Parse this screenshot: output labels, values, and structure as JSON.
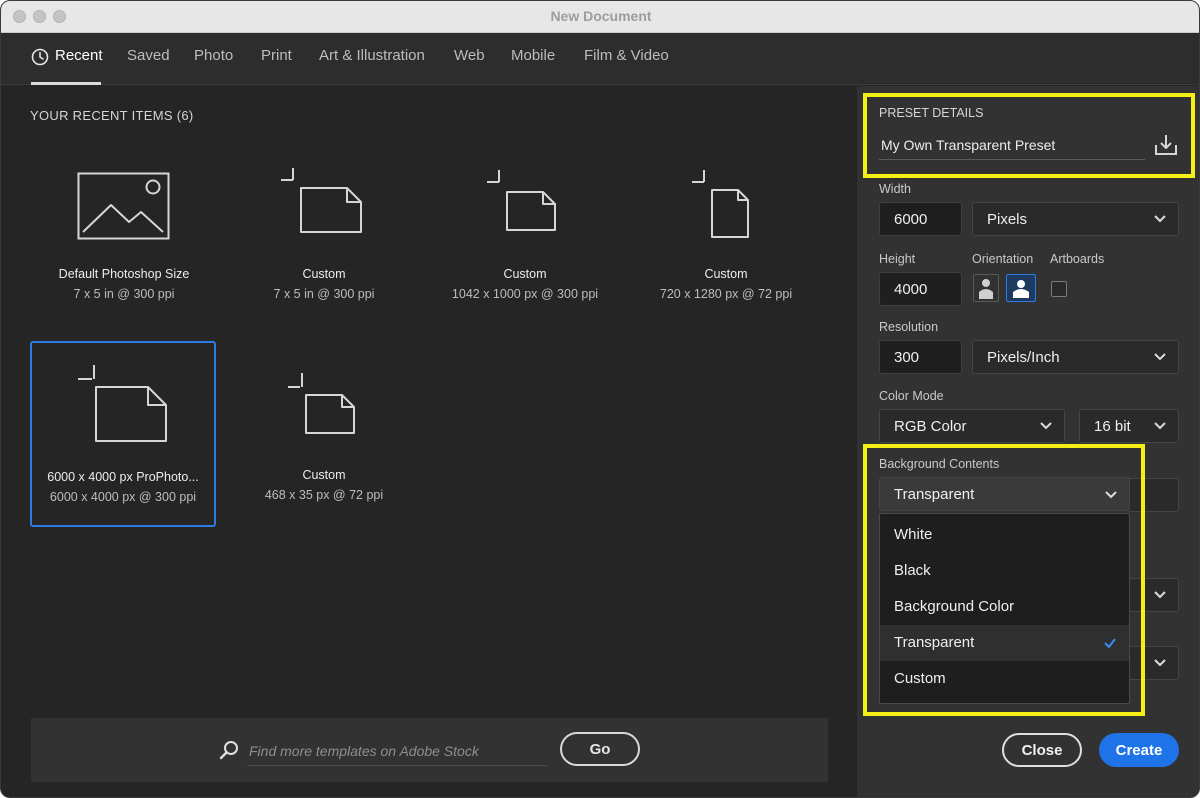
{
  "window": {
    "title": "New Document"
  },
  "tabs": [
    {
      "label": "Recent"
    },
    {
      "label": "Saved"
    },
    {
      "label": "Photo"
    },
    {
      "label": "Print"
    },
    {
      "label": "Art & Illustration"
    },
    {
      "label": "Web"
    },
    {
      "label": "Mobile"
    },
    {
      "label": "Film & Video"
    }
  ],
  "recent": {
    "heading": "YOUR RECENT ITEMS",
    "count": "(6)",
    "items": [
      {
        "name": "Default Photoshop Size",
        "sub": "7 x 5 in @ 300 ppi",
        "icon": "image-icon"
      },
      {
        "name": "Custom",
        "sub": "7 x 5 in @ 300 ppi",
        "icon": "document-icon"
      },
      {
        "name": "Custom",
        "sub": "1042 x 1000 px @ 300 ppi",
        "icon": "document-icon"
      },
      {
        "name": "Custom",
        "sub": "720 x 1280 px @ 72 ppi",
        "icon": "document-portrait-icon"
      },
      {
        "name": "6000 x 4000 px ProPhoto...",
        "sub": "6000 x 4000 px @ 300 ppi",
        "icon": "document-icon",
        "selected": true
      },
      {
        "name": "Custom",
        "sub": "468 x 35 px @ 72 ppi",
        "icon": "document-icon"
      }
    ]
  },
  "search": {
    "placeholder": "Find more templates on Adobe Stock",
    "go_label": "Go"
  },
  "preset": {
    "heading": "PRESET DETAILS",
    "name": "My Own Transparent Preset",
    "width_label": "Width",
    "width": "6000",
    "width_unit": "Pixels",
    "height_label": "Height",
    "height": "4000",
    "orientation_label": "Orientation",
    "artboards_label": "Artboards",
    "resolution_label": "Resolution",
    "resolution": "300",
    "resolution_unit": "Pixels/Inch",
    "color_mode_label": "Color Mode",
    "color_mode": "RGB Color",
    "bit_depth": "16 bit",
    "background_label": "Background Contents",
    "background": "Transparent",
    "background_options": [
      "White",
      "Black",
      "Background Color",
      "Transparent",
      "Custom"
    ]
  },
  "actions": {
    "close_label": "Close",
    "create_label": "Create"
  },
  "colors": {
    "highlight": "#f4f016",
    "accent": "#1e73e8",
    "selection": "#2d7be0"
  }
}
